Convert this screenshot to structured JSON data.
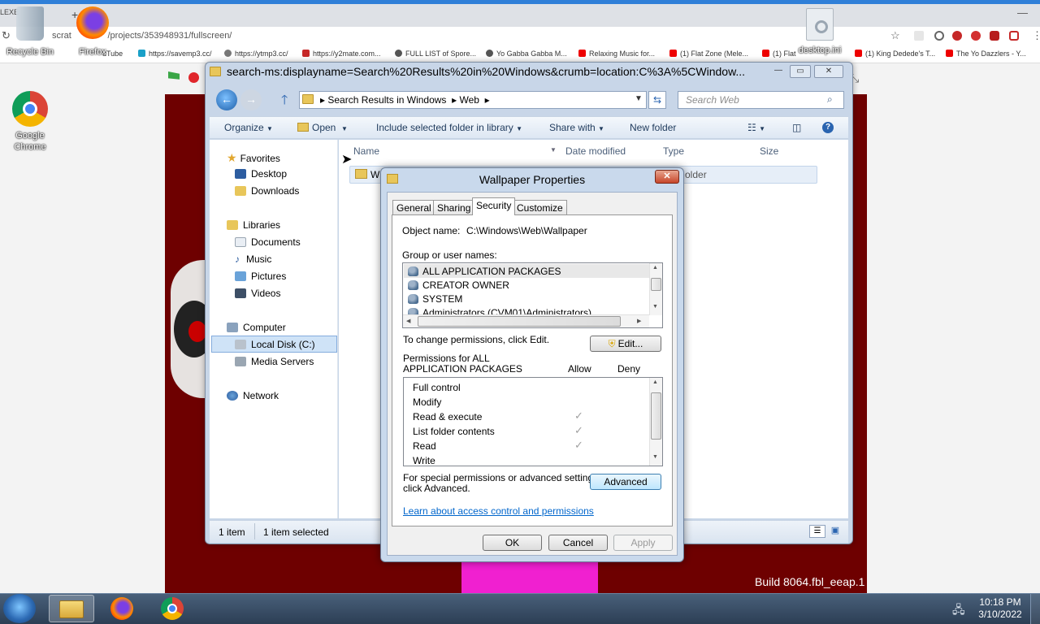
{
  "browser": {
    "url": "scratch.mit.edu/projects/353948931/fullscreen/",
    "url_visible": "/projects/353948931/fullscreen/",
    "tab_fragment": "LEXE",
    "bookmarks": [
      "uTube",
      "https://savemp3.cc/",
      "https://ytmp3.cc/",
      "https://y2mate.com...",
      "FULL LIST of Spore...",
      "Yo Gabba Gabba M...",
      "Relaxing Music for...",
      "(1) Flat Zone (Mele...",
      "(1) Flat",
      "(1) King Dedede's T...",
      "The Yo Dazzlers - Y..."
    ]
  },
  "desktop": {
    "icons": [
      {
        "label": "Recycle Bin",
        "icon": "recycle-bin-icon"
      },
      {
        "label": "Firefox",
        "icon": "firefox-icon"
      },
      {
        "label": "Google Chrome",
        "icon": "chrome-icon"
      },
      {
        "label": "desktop.ini",
        "icon": "settings-file-icon"
      }
    ]
  },
  "stage": {
    "build_text": "Build 8064.fbl_eeap.1"
  },
  "explorer": {
    "title": "search-ms:displayname=Search%20Results%20in%20Windows&crumb=location:C%3A%5CWindow...",
    "breadcrumb": [
      "Search Results in Windows",
      "Web"
    ],
    "search_placeholder": "Search Web",
    "commands": {
      "organize": "Organize",
      "open": "Open",
      "include": "Include selected folder in library",
      "share": "Share with",
      "new_folder": "New folder"
    },
    "nav": {
      "favorites": "Favorites",
      "desktop": "Desktop",
      "downloads": "Downloads",
      "libraries": "Libraries",
      "documents": "Documents",
      "music": "Music",
      "pictures": "Pictures",
      "videos": "Videos",
      "computer": "Computer",
      "local_disk": "Local Disk (C:)",
      "media_servers": "Media Servers",
      "network": "Network"
    },
    "columns": {
      "name": "Name",
      "date_modified": "Date modified",
      "type": "Type",
      "size": "Size"
    },
    "row": {
      "name_partial": "W",
      "type_partial": "older"
    },
    "status": {
      "items": "1 item",
      "selected": "1 item selected"
    }
  },
  "dialog": {
    "title": "Wallpaper Properties",
    "tabs": [
      "General",
      "Sharing",
      "Security",
      "Customize"
    ],
    "active_tab": "Security",
    "object_name_label": "Object name:",
    "object_name_value": "C:\\Windows\\Web\\Wallpaper",
    "group_label": "Group or user names:",
    "groups": [
      "ALL APPLICATION PACKAGES",
      "CREATOR OWNER",
      "SYSTEM",
      "Administrators (CVM01\\Administrators)"
    ],
    "change_text": "To change permissions, click Edit.",
    "edit_button": "Edit...",
    "perm_header_line1": "Permissions for ALL",
    "perm_header_line2": "APPLICATION PACKAGES",
    "allow_label": "Allow",
    "deny_label": "Deny",
    "permissions": [
      {
        "name": "Full control",
        "allow": false
      },
      {
        "name": "Modify",
        "allow": false
      },
      {
        "name": "Read & execute",
        "allow": true
      },
      {
        "name": "List folder contents",
        "allow": true
      },
      {
        "name": "Read",
        "allow": true
      },
      {
        "name": "Write",
        "allow": false
      }
    ],
    "special_line1": "For special permissions or advanced settings,",
    "special_line2": "click Advanced.",
    "advanced_button": "Advanced",
    "learn_link": "Learn about access control and permissions",
    "ok": "OK",
    "cancel": "Cancel",
    "apply": "Apply"
  },
  "taskbar": {
    "time": "10:18 PM",
    "date": "3/10/2022"
  },
  "colors": {
    "stage_bg": "#6e0000",
    "accent": "#2f7fd8",
    "link": "#0066cc"
  }
}
